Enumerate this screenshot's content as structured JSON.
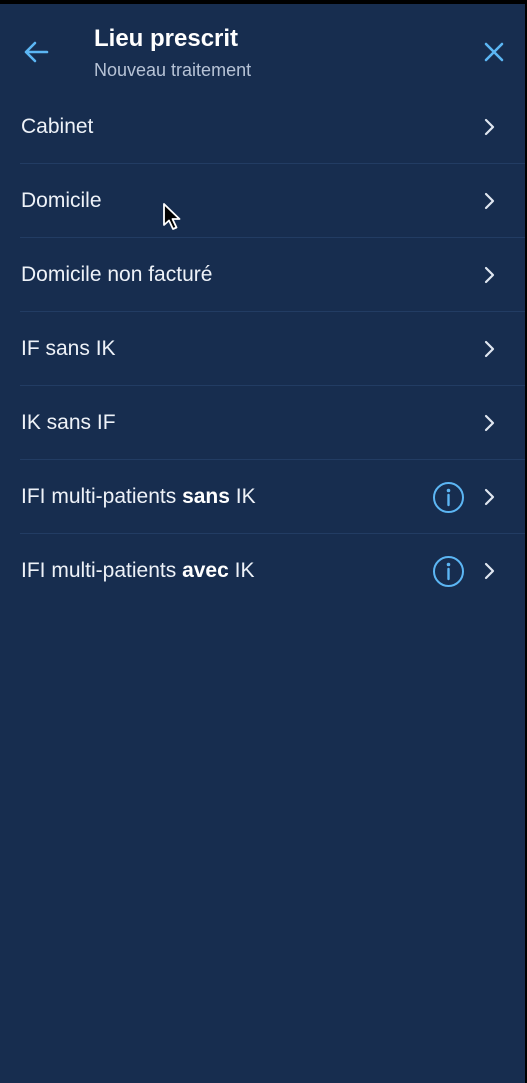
{
  "header": {
    "back_icon": "arrow-left-icon",
    "title": "Lieu prescrit",
    "subtitle": "Nouveau traitement",
    "close_icon": "close-icon"
  },
  "items": [
    {
      "label": "Cabinet",
      "info": false
    },
    {
      "label": "Domicile",
      "info": false
    },
    {
      "label": "Domicile non facturé",
      "info": false
    },
    {
      "label": "IF sans IK",
      "info": false
    },
    {
      "label": "IK sans IF",
      "info": false
    },
    {
      "label_before": "IFI multi-patients ",
      "label_bold": "sans",
      "label_after": " IK",
      "info": true
    },
    {
      "label_before": "IFI multi-patients ",
      "label_bold": "avec",
      "label_after": " IK",
      "info": true
    }
  ],
  "colors": {
    "background": "#172d4f",
    "accent": "#5cb6f4",
    "text": "#eef2f8",
    "subtitle": "#b7c3d6",
    "divider": "#223c63"
  },
  "icons": {
    "chevron": "chevron-right-icon",
    "info": "info-circle-icon",
    "pointer": "mouse-cursor"
  }
}
